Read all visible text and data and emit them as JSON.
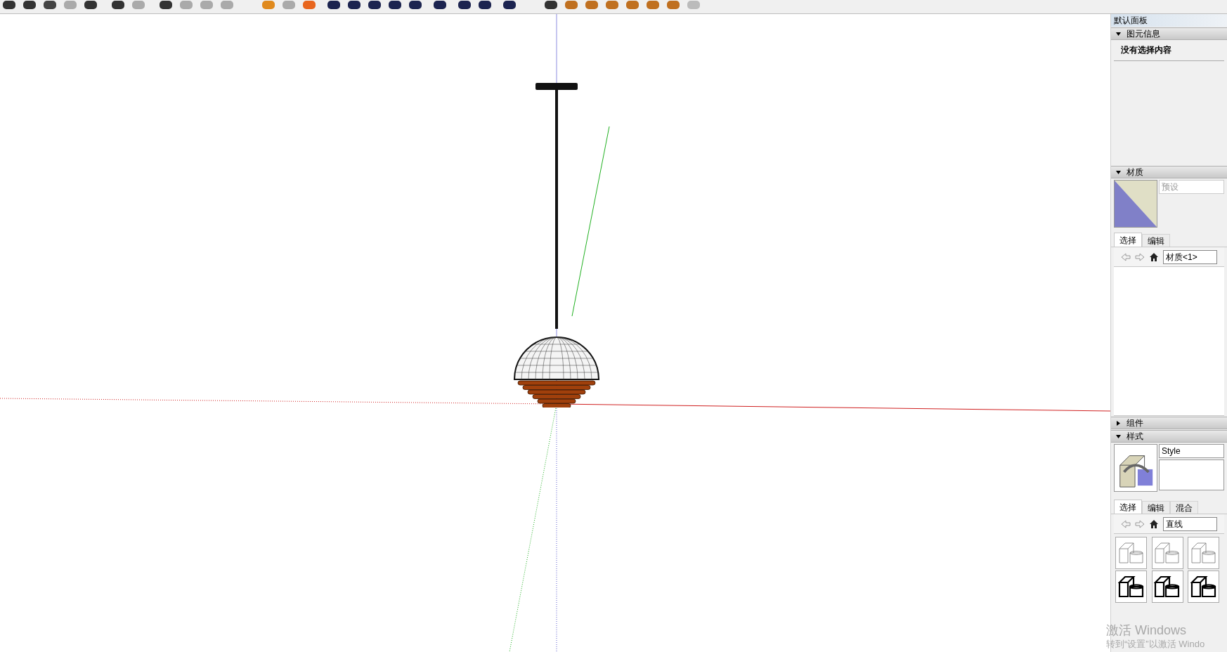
{
  "panel": {
    "title": "默认面板",
    "entity_info": {
      "title": "图元信息",
      "expanded": true,
      "message": "没有选择内容"
    },
    "materials": {
      "title": "材质",
      "expanded": true,
      "placeholder": "预设",
      "tabs": [
        {
          "label": "选择",
          "selected": true
        },
        {
          "label": "编辑",
          "selected": false
        }
      ],
      "collection": "材质<1>"
    },
    "components": {
      "title": "组件",
      "expanded": false
    },
    "styles": {
      "title": "样式",
      "expanded": true,
      "name": "Style",
      "tabs": [
        {
          "label": "选择",
          "selected": true
        },
        {
          "label": "编辑",
          "selected": false
        },
        {
          "label": "混合",
          "selected": false
        }
      ],
      "collection": "直线"
    }
  },
  "activation_notice": {
    "title": "激活 Windows",
    "hint": "转到“设置”以激活 Windo"
  }
}
